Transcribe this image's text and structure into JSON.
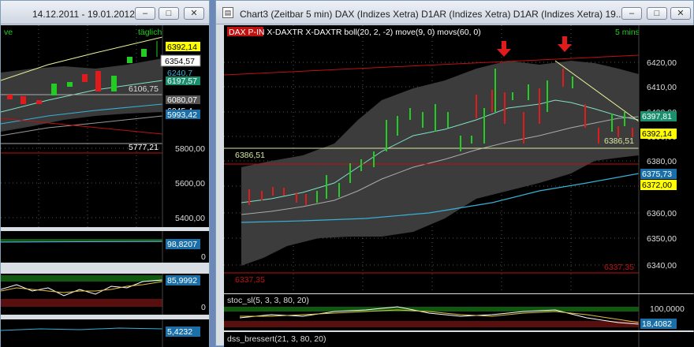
{
  "left_window": {
    "title": "14.12.2011 - 19.01.2012",
    "top_left_text": "ve",
    "interval": "täglich",
    "price_labels": {
      "last": "6392,14",
      "cursor": "6354,57",
      "a": "6240,7",
      "b": "6197,57",
      "c": "6106,75",
      "d": "6080,07",
      "e": "6045,4",
      "f": "5993,42",
      "g": "5777,21"
    },
    "axis_ticks": [
      "5800,00",
      "5600,00",
      "5400,00"
    ],
    "ind1_value": "98,8207",
    "ind1_zero": "0",
    "ind2_value": "85,9992",
    "ind2_zero": "0",
    "ind3_value": "5,4232"
  },
  "right_window": {
    "title": "Chart3 (Zeitbar 5 min)  DAX (Indizes Xetra) D1AR (Indizes Xetra) D1AR (Indizes Xetra) 19....",
    "chart_header": "DAX P-IN  X-DAXTR X-DAXTR boll(20, 2, -2) move(9, 0) movs(60, 0)",
    "interval": "5 mins",
    "axis_ticks": [
      "6420,00",
      "6410,00",
      "6400,00",
      "6390,00",
      "6380,00",
      "6370,00",
      "6360,00",
      "6350,00",
      "6340,00"
    ],
    "price_labels": {
      "upper_band": "6397,81",
      "last": "6392,14",
      "ma60": "6375,73",
      "lower": "6372,00"
    },
    "annotations": {
      "support": "6386,51",
      "support_right": "6386,51",
      "low_left": "6337,35",
      "low_right": "6337,35"
    },
    "stoch_header": "stoc_sl(5, 3, 3, 80, 20)",
    "stoch_max": "100,0000",
    "stoch_value": "18,4082",
    "stoch_zero": "0",
    "dss_header": "dss_bressert(21, 3, 80, 20)"
  },
  "colors": {
    "background": "#000000",
    "bull": "#22cc22",
    "bear": "#e01b1b",
    "band": "#7a7a7a",
    "ma_fast": "#7fe0c8",
    "ma_slow": "#38b0d8",
    "support": "#d8e8a0",
    "resistance": "#c01010",
    "highlight": "#ffff00"
  }
}
